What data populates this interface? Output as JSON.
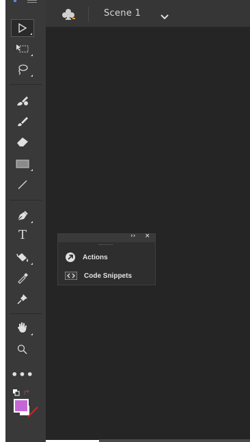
{
  "header": {
    "scene_label": "Scene 1"
  },
  "panel": {
    "expand_glyph": "››",
    "close_glyph": "×",
    "items": [
      {
        "label": "Actions",
        "icon": "actions-icon"
      },
      {
        "label": "Code Snippets",
        "icon": "code-snippets-icon"
      }
    ]
  },
  "tools": {
    "text_tool_glyph": "T",
    "more_tools_glyph": "•••"
  },
  "colors": {
    "fill": "#c566d6",
    "stroke": "#ffffff",
    "stage": "#252525",
    "toolbar": "#393939",
    "header": "#363636"
  }
}
